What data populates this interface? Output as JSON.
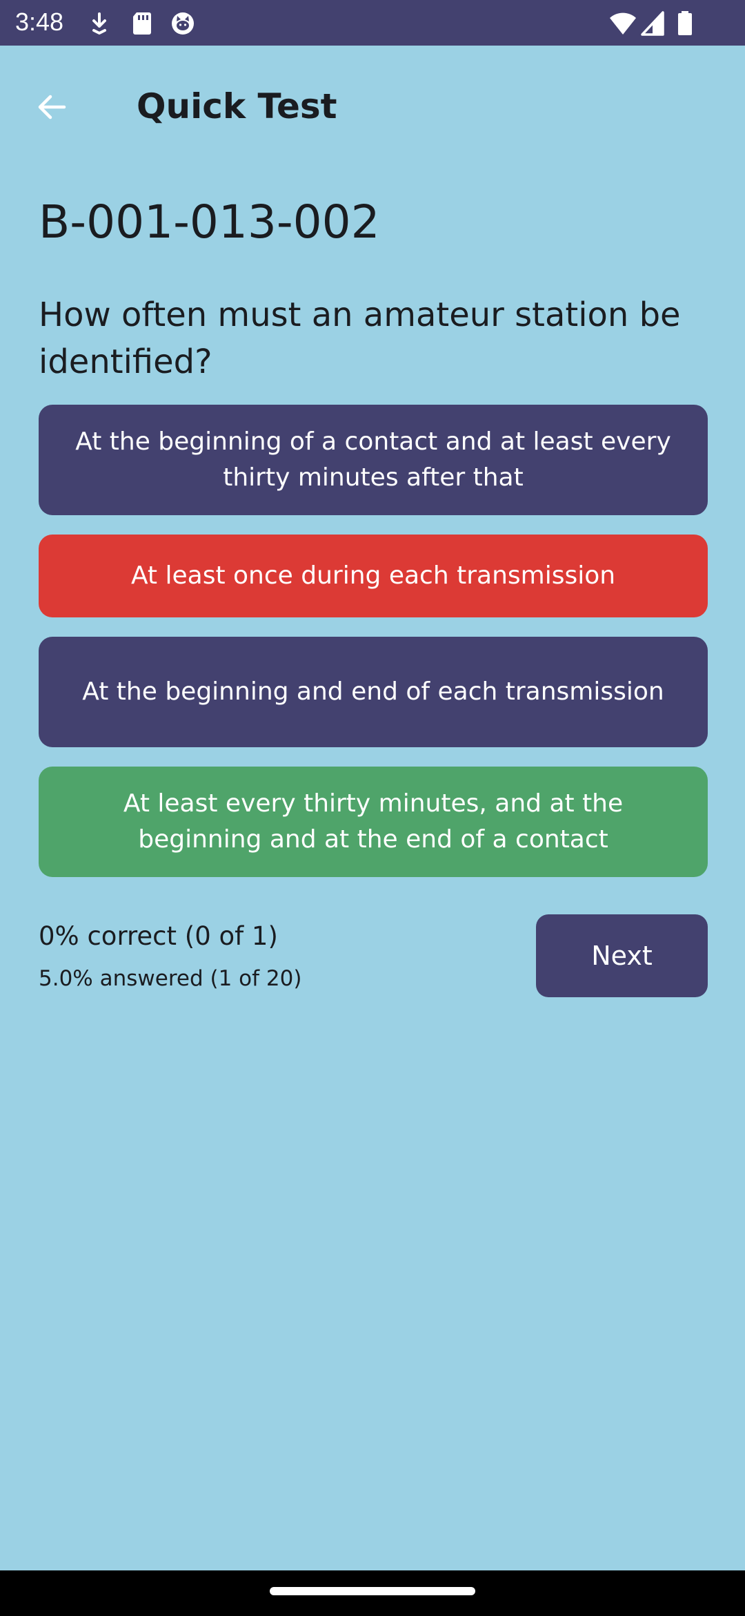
{
  "status_bar": {
    "time": "3:48",
    "left_icons": [
      "download-status-icon",
      "sd-card-icon",
      "cat-face-icon"
    ],
    "right_icons": [
      "wifi-icon",
      "signal-icon",
      "battery-icon"
    ]
  },
  "app_bar": {
    "title": "Quick Test",
    "back_icon": "arrow-left-icon"
  },
  "question": {
    "id": "B-001-013-002",
    "text": "How often must an amateur station be identified?"
  },
  "answers": [
    {
      "label": "At the beginning of a contact and at least every thirty minutes after that",
      "state": "neutral"
    },
    {
      "label": "At least once during each transmission",
      "state": "wrong"
    },
    {
      "label": "At the beginning and end of each transmission",
      "state": "neutral"
    },
    {
      "label": "At least every thirty minutes, and at the beginning and at the end of a contact",
      "state": "correct"
    }
  ],
  "stats": {
    "correct_text": "0% correct (0 of 1)",
    "answered_text": "5.0% answered (1 of 20)"
  },
  "next_label": "Next",
  "colors": {
    "background": "#9bd1e4",
    "primary": "#43416f",
    "wrong": "#dc3a35",
    "correct": "#4fa46a"
  }
}
